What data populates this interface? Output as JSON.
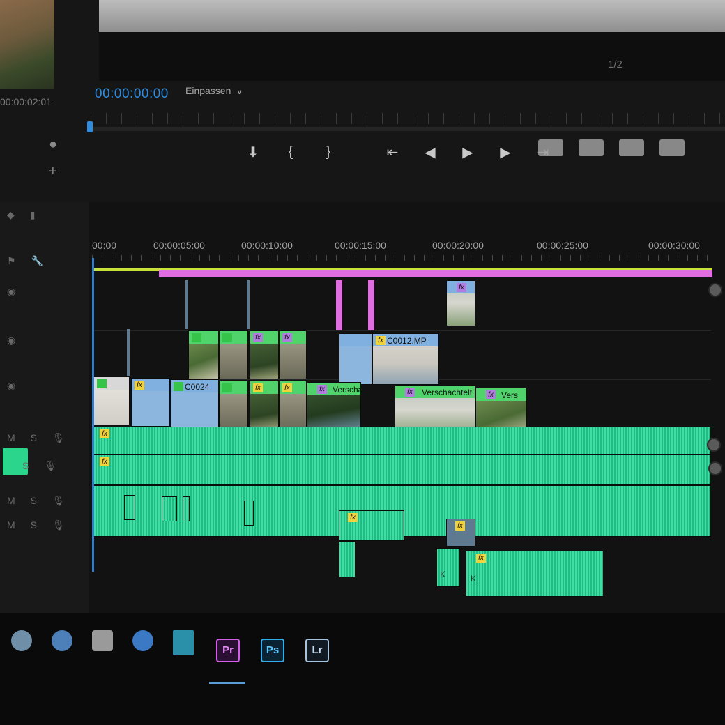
{
  "monitor": {
    "source_timecode": "00:00:02:01",
    "playhead_timecode": "00:00:00:00",
    "fit_label": "Einpassen",
    "fit_chevron": "chevron-down-icon",
    "resolution_label": "1/2"
  },
  "transport": {
    "icons": [
      "add-marker-icon",
      "mark-in-icon",
      "mark-out-icon",
      "go-to-in-icon",
      "step-back-icon",
      "play-icon",
      "step-forward-icon",
      "go-to-out-icon",
      "lift-icon",
      "extract-icon",
      "export-frame-icon",
      "compare-icon"
    ],
    "glyphs": [
      "⬇",
      "{",
      "}",
      "⇤",
      "◀",
      "▶",
      "▶",
      "⇥"
    ]
  },
  "timeline": {
    "ruler": [
      "00:00",
      "00:00:05:00",
      "00:00:10:00",
      "00:00:15:00",
      "00:00:20:00",
      "00:00:25:00",
      "00:00:30:00"
    ],
    "clips": {
      "c0012": "C0012.MP",
      "c0024": "C0024",
      "nested_1": "Verscha",
      "nested_2": "Verschachtelt",
      "nested_3": "Vers",
      "fx": "fx",
      "keyframe": "K"
    }
  },
  "colors": {
    "accent_blue": "#2e8de0",
    "audio_green": "#3be0a4",
    "work_area_yellow": "#c9e23a",
    "work_area_pink": "#e06ee0"
  },
  "taskbar": {
    "premiere": "Pr",
    "photoshop": "Ps",
    "lightroom": "Lr"
  }
}
